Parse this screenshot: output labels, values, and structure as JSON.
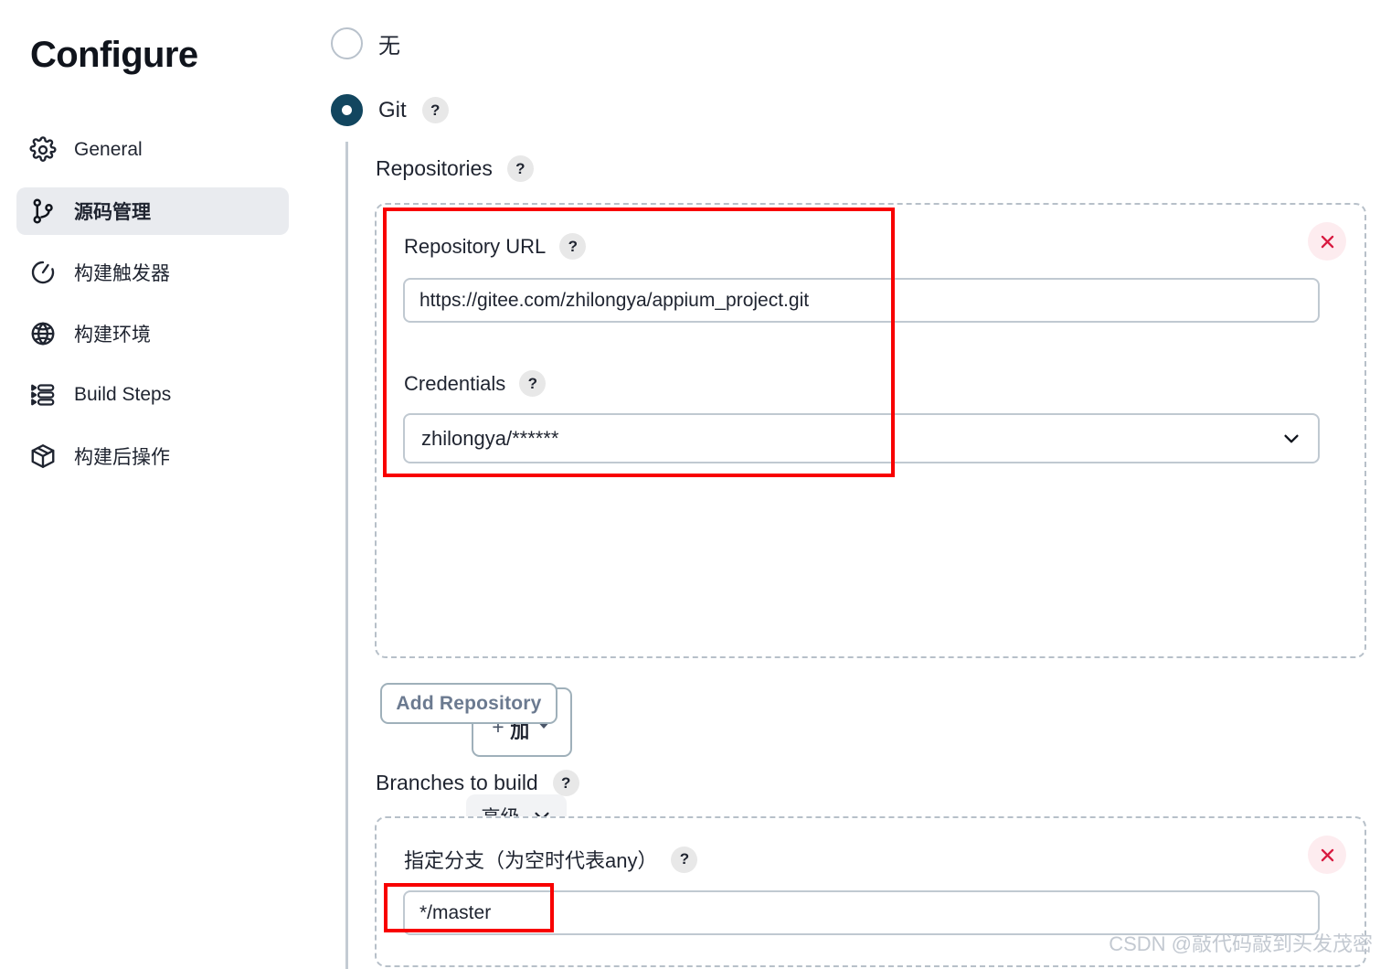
{
  "sidebar": {
    "title": "Configure",
    "items": [
      {
        "label": "General",
        "icon": "gear-icon",
        "active": false
      },
      {
        "label": "源码管理",
        "icon": "git-branch-icon",
        "active": true
      },
      {
        "label": "构建触发器",
        "icon": "clock-icon",
        "active": false
      },
      {
        "label": "构建环境",
        "icon": "globe-icon",
        "active": false
      },
      {
        "label": "Build Steps",
        "icon": "list-icon",
        "active": false
      },
      {
        "label": "构建后操作",
        "icon": "package-icon",
        "active": false
      }
    ]
  },
  "scm": {
    "options": [
      {
        "label": "无",
        "selected": false,
        "has_help": false
      },
      {
        "label": "Git",
        "selected": true,
        "has_help": true
      }
    ],
    "help_glyph": "?",
    "repositories": {
      "label": "Repositories",
      "repository_url": {
        "label": "Repository URL",
        "value": "https://gitee.com/zhilongya/appium_project.git",
        "placeholder": ""
      },
      "credentials": {
        "label": "Credentials",
        "value": "zhilongya/******"
      },
      "add_button": {
        "plus": "+",
        "label": "添加"
      },
      "advanced_button": {
        "label": "高级"
      },
      "delete_button": "remove-repository",
      "add_repository_button": {
        "label": "Add Repository"
      }
    },
    "branches": {
      "label": "Branches to build",
      "branch_specifier": {
        "label": "指定分支（为空时代表any）",
        "value": "*/master"
      },
      "delete_button": "remove-branch"
    }
  },
  "colors": {
    "accent": "#12465f",
    "annotation": "#f80000",
    "delete_bg": "#fdecef",
    "delete_fg": "#d81b41",
    "active_nav_bg": "#e9ebef"
  },
  "watermark": "CSDN @敲代码敲到头发茂密"
}
